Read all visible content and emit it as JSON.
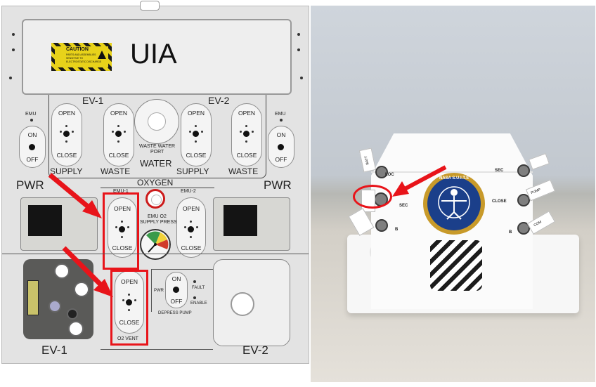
{
  "left_panel": {
    "title": "UIA",
    "caution": {
      "heading": "CAUTION",
      "lines": [
        "PARTS AND ASSEMBLIES",
        "SENSITIVE TO",
        "ELECTROSTATIC DISCHARGE"
      ]
    },
    "ev1_header": "EV-1",
    "ev2_header": "EV-2",
    "emu_left": {
      "label": "EMU",
      "on": "ON",
      "off": "OFF"
    },
    "emu_right": {
      "label": "EMU",
      "on": "ON",
      "off": "OFF"
    },
    "switches": {
      "ev1_supply": {
        "open": "OPEN",
        "close": "CLOSE"
      },
      "ev1_waste": {
        "open": "OPEN",
        "close": "CLOSE"
      },
      "ev2_supply": {
        "open": "OPEN",
        "close": "CLOSE"
      },
      "ev2_waste": {
        "open": "OPEN",
        "close": "CLOSE"
      },
      "emu1_o2": {
        "open": "OPEN",
        "close": "CLOSE"
      },
      "emu2_o2": {
        "open": "OPEN",
        "close": "CLOSE"
      },
      "o2_vent": {
        "open": "OPEN",
        "close": "CLOSE"
      }
    },
    "waste_water_port": [
      "WASTE WATER",
      "PORT"
    ],
    "water_row": {
      "supply1": "SUPPLY",
      "waste1": "WASTE",
      "water": "WATER",
      "supply2": "SUPPLY",
      "waste2": "WASTE"
    },
    "pwr_left": "PWR",
    "pwr_right": "PWR",
    "oxygen": "OXYGEN",
    "emu1": "EMU-1",
    "emu2": "EMU-2",
    "emu_o2_supply_press": [
      "EMU O2",
      "SUPPLY PRESS"
    ],
    "o2_vent": "O2 VENT",
    "depress_pump": {
      "pwr": "PWR",
      "on": "ON",
      "off": "OFF",
      "fault": "FAULT",
      "enable": "ENABLE",
      "label": "DEPRESS PUMP"
    },
    "ev1_bottom": "EV-1",
    "ev2_bottom": "EV-2"
  },
  "right_photo": {
    "labels": {
      "batt": "BATT",
      "loc": "LOC",
      "sec_left": "SEC",
      "b_left": "B",
      "sec_right": "SEC",
      "close": "CLOSE",
      "b_right": "B",
      "pump": "PUMP",
      "com": "COM"
    },
    "badge_text": "NASA S.U.I.T.S"
  },
  "colors": {
    "highlight_red": "#e8141a",
    "panel_gray": "#e3e3e3",
    "caution_yellow": "#e8d21a"
  }
}
